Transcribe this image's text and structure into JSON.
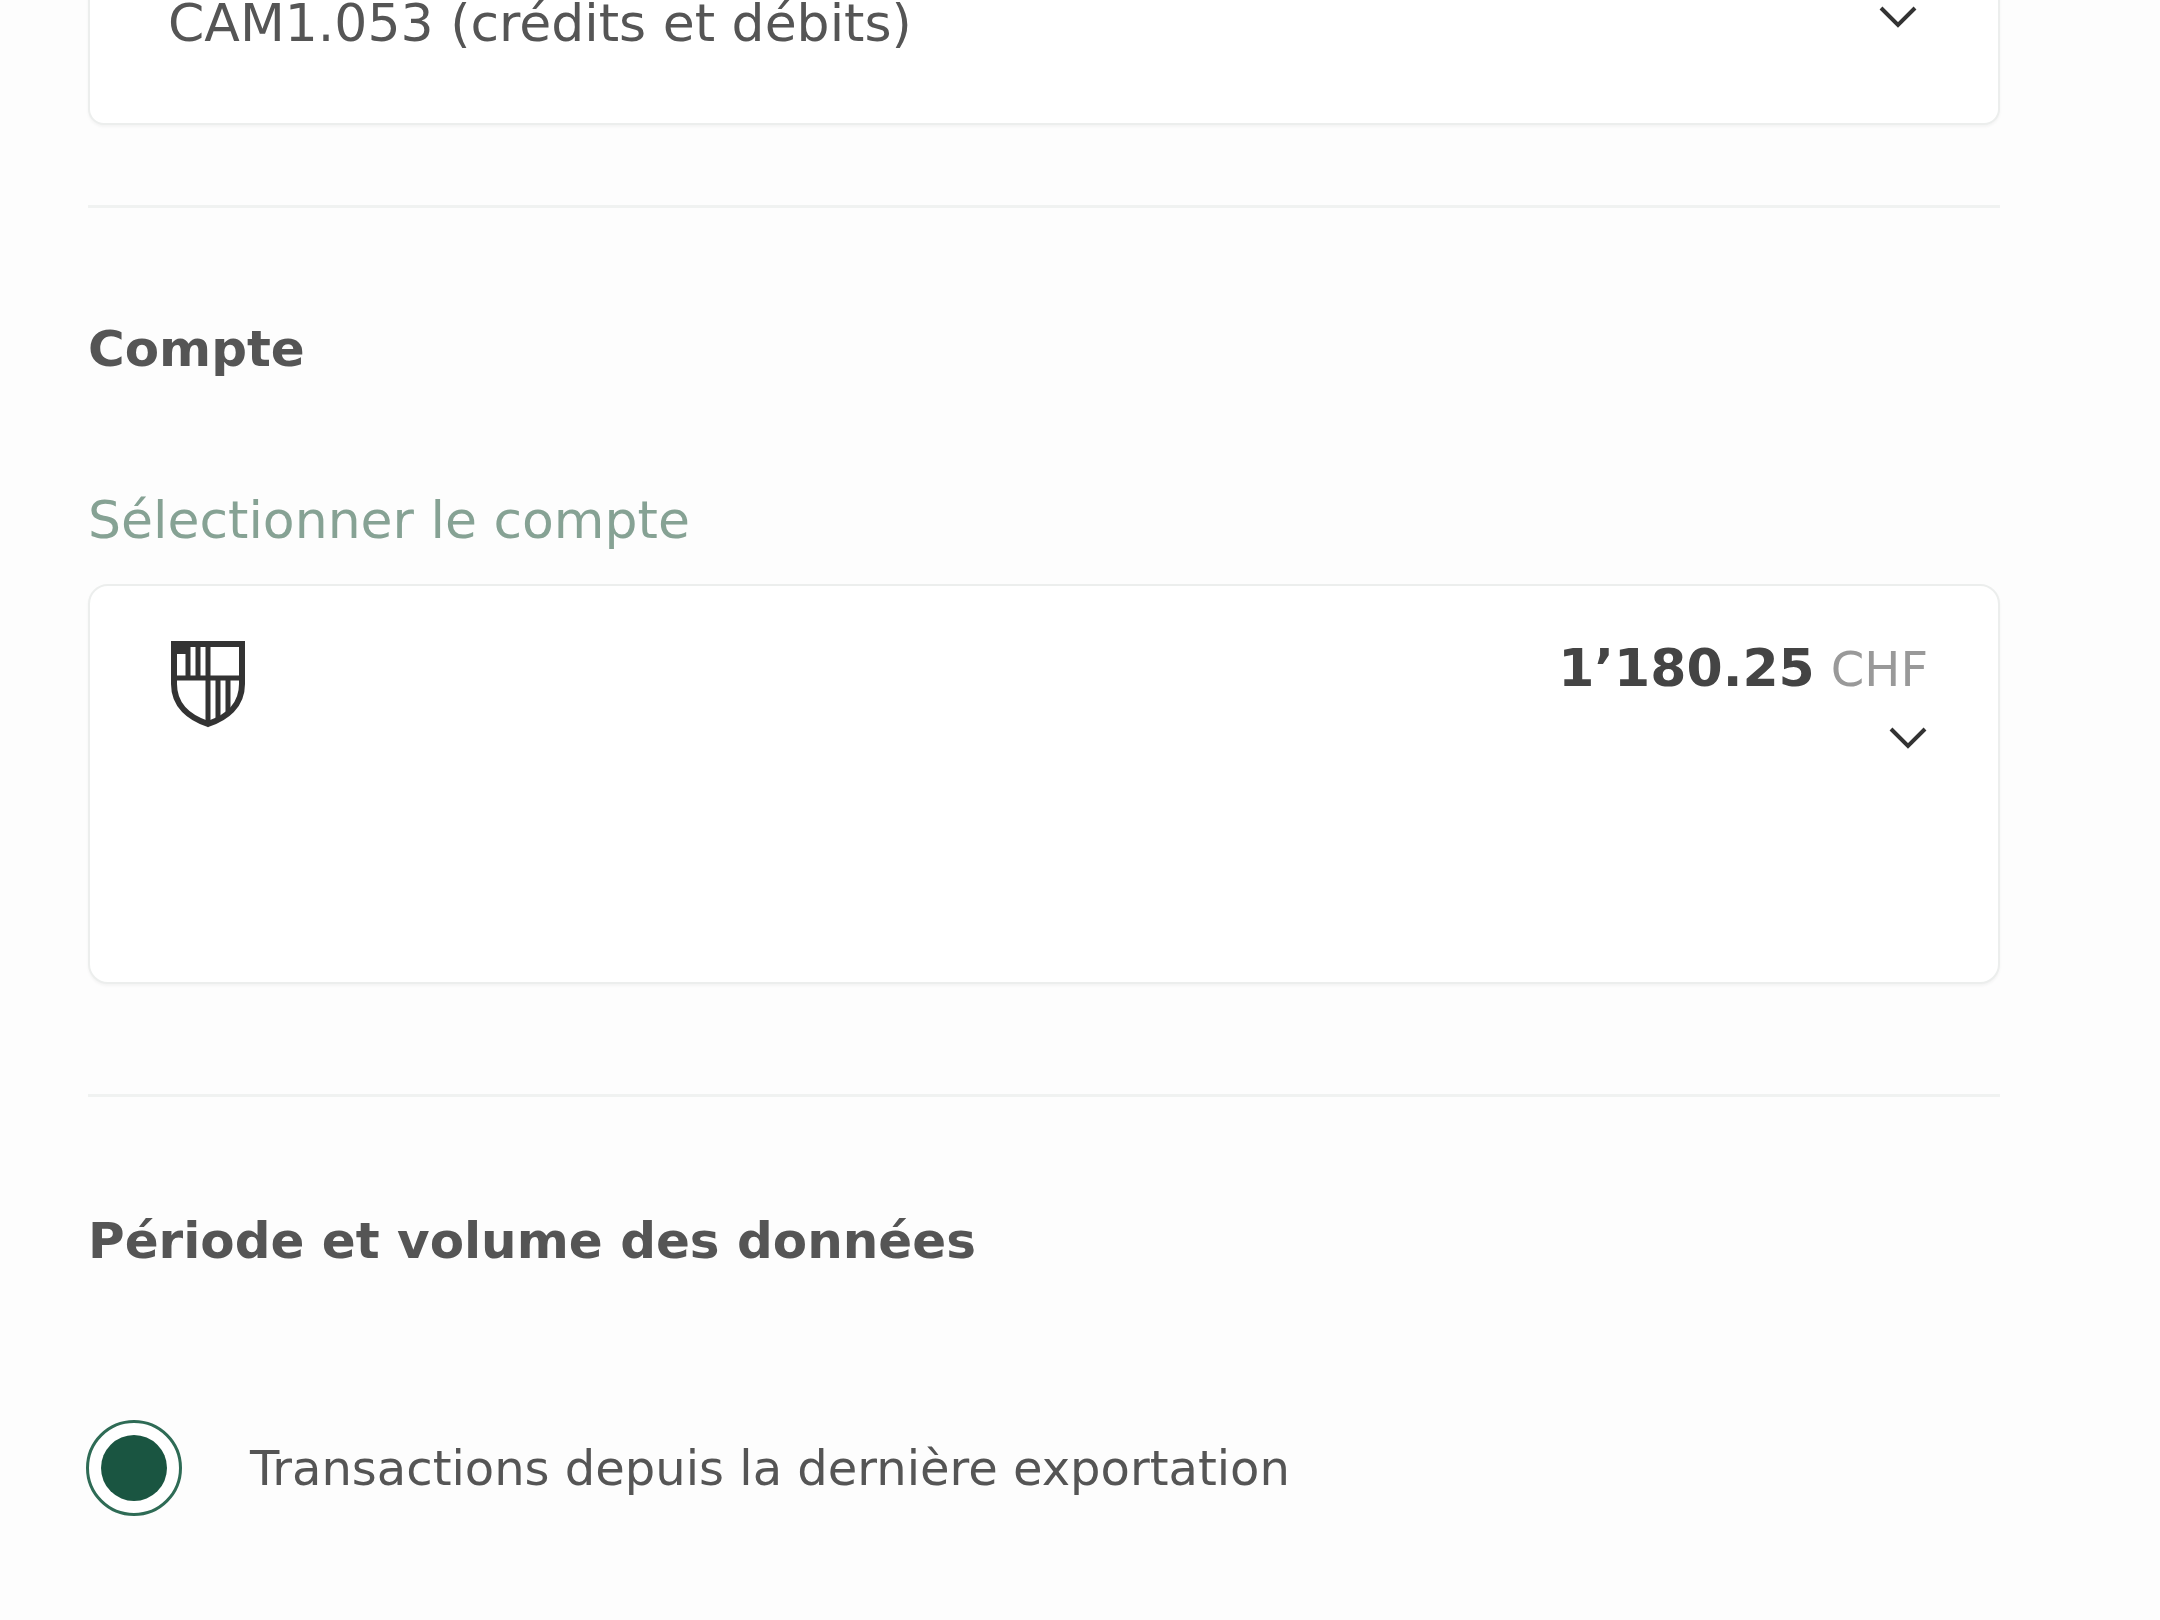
{
  "format_select": {
    "value": "CAM1.053 (crédits et débits)"
  },
  "account_section": {
    "heading": "Compte",
    "field_label": "Sélectionner le compte",
    "account": {
      "amount": "1’180.25",
      "currency": "CHF"
    }
  },
  "period_section": {
    "heading": "Période et volume des données",
    "options": [
      {
        "label": "Transactions depuis la dernière exportation",
        "selected": true
      }
    ]
  }
}
